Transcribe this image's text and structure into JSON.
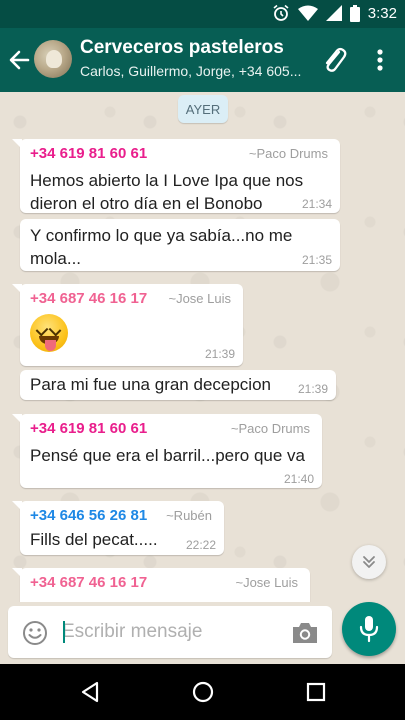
{
  "status_bar": {
    "time": "3:32"
  },
  "header": {
    "title": "Cerveceros pasteleros",
    "subtitle": "Carlos, Guillermo, Jorge, +34 605..."
  },
  "date_divider": "AYER",
  "messages": [
    {
      "sender": "+34 619 81 60 61",
      "alias": "~Paco Drums",
      "sender_color": "#e91e8c",
      "text": [
        "Hemos abierto la I Love Ipa que nos",
        "dieron el otro día en el Bonobo"
      ],
      "time": "21:34"
    },
    {
      "text": [
        "Y confirmo lo que ya sabía...no me",
        "mola..."
      ],
      "time": "21:35"
    },
    {
      "sender": "+34 687 46 16 17",
      "alias": "~Jose Luis",
      "sender_color": "#f06292",
      "emoji": "face-with-tongue-winking",
      "time": "21:39"
    },
    {
      "text": [
        "Para mi fue una gran decepcion"
      ],
      "time": "21:39"
    },
    {
      "sender": "+34 619 81 60 61",
      "alias": "~Paco Drums",
      "sender_color": "#e91e8c",
      "text": [
        "Pensé que era el barril...pero que va"
      ],
      "time": "21:40"
    },
    {
      "sender": "+34 646 56 26 81",
      "alias": "~Rubén",
      "sender_color": "#1e88e5",
      "text": [
        "Fills del pecat....."
      ],
      "time": "22:22"
    },
    {
      "sender": "+34 687 46 16 17",
      "alias": "~Jose Luis",
      "sender_color": "#f06292"
    }
  ],
  "composer": {
    "placeholder": "Escribir mensaje"
  },
  "colors": {
    "header": "#075e54",
    "status_bar": "#054d44",
    "accent": "#00897b"
  }
}
